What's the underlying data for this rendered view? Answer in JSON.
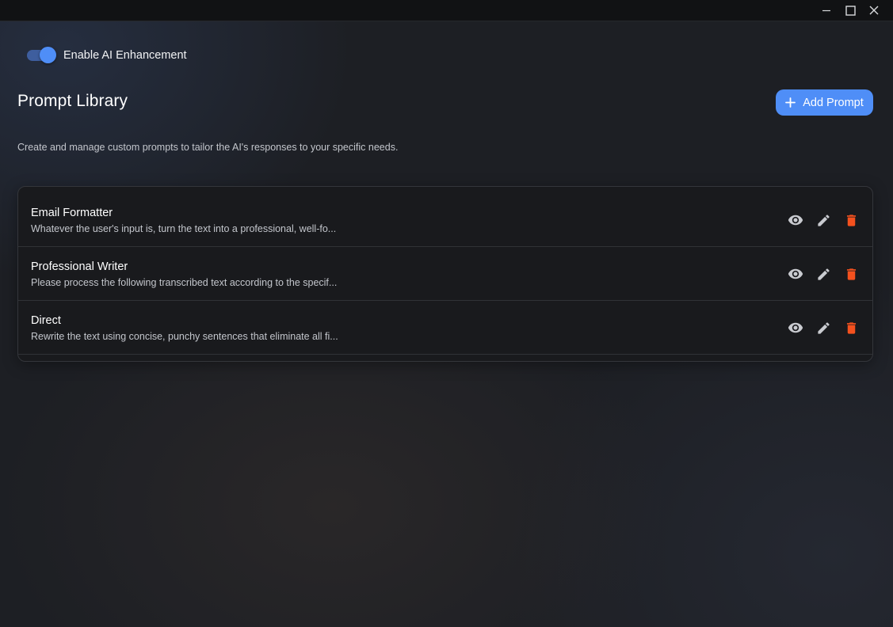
{
  "window": {
    "controls": {
      "minimize_icon": "minimize-icon",
      "maximize_icon": "maximize-icon",
      "close_icon": "close-icon"
    }
  },
  "ai_toggle": {
    "label": "Enable AI Enhancement",
    "enabled": true,
    "accent_color": "#4f8ef7"
  },
  "header": {
    "title": "Prompt Library",
    "add_button_label": "Add Prompt",
    "add_button_icon": "plus-icon",
    "description": "Create and manage custom prompts to tailor the AI's responses to your specific needs."
  },
  "prompts": [
    {
      "title": "Email Formatter",
      "preview": "Whatever the user's input is, turn the text into a professional, well-fo..."
    },
    {
      "title": "Professional Writer",
      "preview": "Please process the following transcribed text according to the specif..."
    },
    {
      "title": "Direct",
      "preview": "Rewrite the text using concise, punchy sentences that eliminate all fi..."
    }
  ],
  "row_actions": {
    "view_icon": "eye-icon",
    "edit_icon": "pencil-icon",
    "delete_icon": "trash-icon",
    "delete_color": "#f4511e"
  }
}
